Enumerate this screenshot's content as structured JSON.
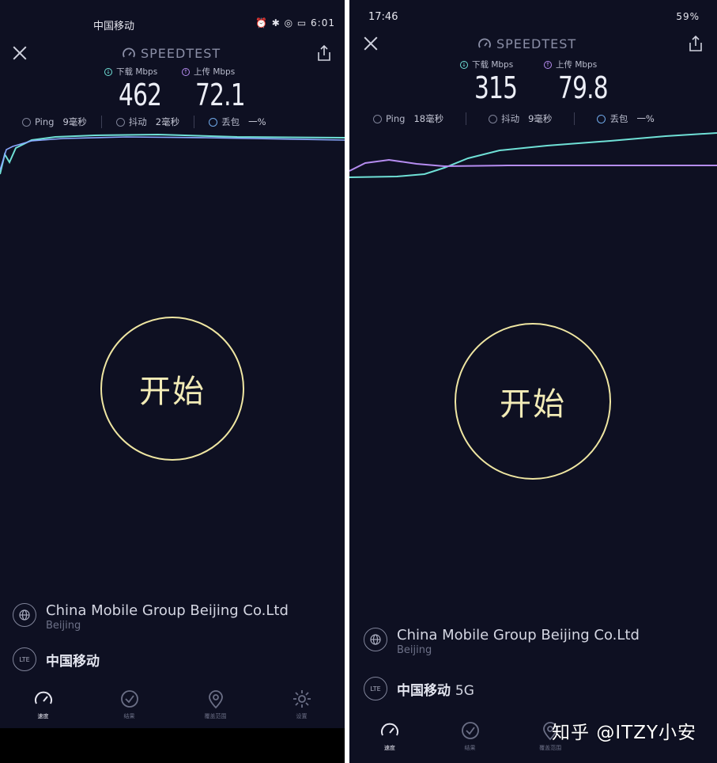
{
  "left": {
    "status": {
      "carrier": "中国移动",
      "right": "⏰ ✱ ◎ ▭ 6:01"
    },
    "brand": "SPEEDTEST",
    "download_label": "下载 Mbps",
    "upload_label": "上传 Mbps",
    "download": "462",
    "upload": "72.1",
    "ping_label": "Ping",
    "ping": "9毫秒",
    "jitter_label": "抖动",
    "jitter": "2毫秒",
    "loss_label": "丢包",
    "loss": "一%",
    "start": "开始",
    "isp_name": "China Mobile Group Beijing Co.Ltd",
    "isp_location": "Beijing",
    "lte_badge": "LTE",
    "network": "中国移动",
    "network_suffix": "",
    "tabs": [
      {
        "label": "速度",
        "icon": "speed-gauge-icon"
      },
      {
        "label": "结果",
        "icon": "check-circle-icon"
      },
      {
        "label": "覆盖范围",
        "icon": "map-pin-icon"
      },
      {
        "label": "设置",
        "icon": "gear-icon"
      }
    ]
  },
  "right": {
    "status": {
      "time": "17:46",
      "right": "59%"
    },
    "brand": "SPEEDTEST",
    "download_label": "下载 Mbps",
    "upload_label": "上传 Mbps",
    "download": "315",
    "upload": "79.8",
    "ping_label": "Ping",
    "ping": "18毫秒",
    "jitter_label": "抖动",
    "jitter": "9毫秒",
    "loss_label": "丢包",
    "loss": "一%",
    "start": "开始",
    "isp_name": "China Mobile Group Beijing Co.Ltd",
    "isp_location": "Beijing",
    "lte_badge": "LTE",
    "network": "中国移动",
    "network_suffix": "5G",
    "tabs": [
      {
        "label": "速度",
        "icon": "speed-gauge-icon"
      },
      {
        "label": "结果",
        "icon": "check-circle-icon"
      },
      {
        "label": "覆盖范围",
        "icon": "map-pin-icon"
      }
    ]
  },
  "watermark": "知乎 @ITZY小安",
  "colors": {
    "background": "#0e1022",
    "download": "#6fe0d6",
    "upload": "#b58cf0",
    "start_ring": "#efe6a2"
  }
}
